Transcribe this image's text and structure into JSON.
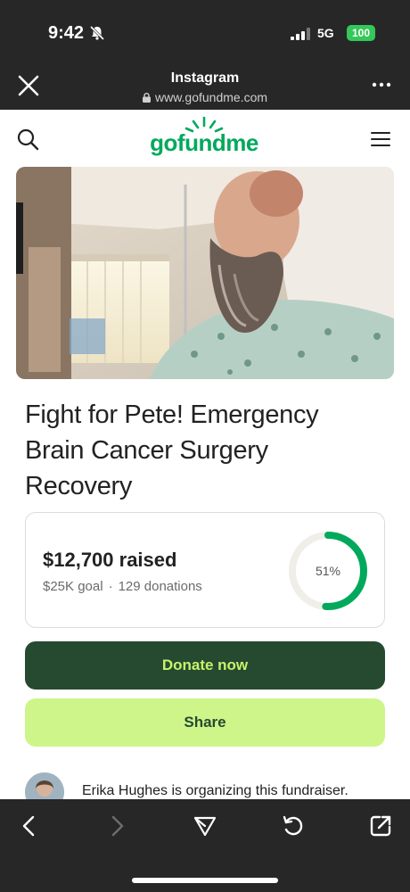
{
  "status_bar": {
    "time": "9:42",
    "network": "5G",
    "battery": "100",
    "icons": [
      "bell-slash-icon",
      "signal-icon",
      "battery-icon"
    ]
  },
  "browser": {
    "title": "Instagram",
    "url": "www.gofundme.com",
    "icons": [
      "close-icon",
      "lock-icon",
      "more-icon"
    ]
  },
  "site_nav": {
    "logo": "gofundme",
    "icons": [
      "search-icon",
      "menu-icon"
    ]
  },
  "campaign": {
    "title": "Fight for Pete! Emergency Brain Cancer Surgery Recovery",
    "raised": "$12,700 raised",
    "goal": "$25K goal",
    "separator": "·",
    "donations": "129 donations",
    "progress_label": "51%",
    "progress_fraction": 0.51
  },
  "actions": {
    "donate_label": "Donate now",
    "share_label": "Share"
  },
  "organizer": {
    "text": "Erika Hughes is organizing this fundraiser."
  },
  "bottom_toolbar": {
    "icons": [
      "back-icon",
      "forward-icon",
      "send-icon",
      "reload-icon",
      "open-external-icon"
    ]
  },
  "colors": {
    "brand_green": "#02a95c",
    "donate_bg": "#254a30",
    "donate_text": "#c8f26a",
    "share_bg": "#cdf58a",
    "progress_ring": "#02a95c",
    "progress_track": "#efeee9"
  }
}
